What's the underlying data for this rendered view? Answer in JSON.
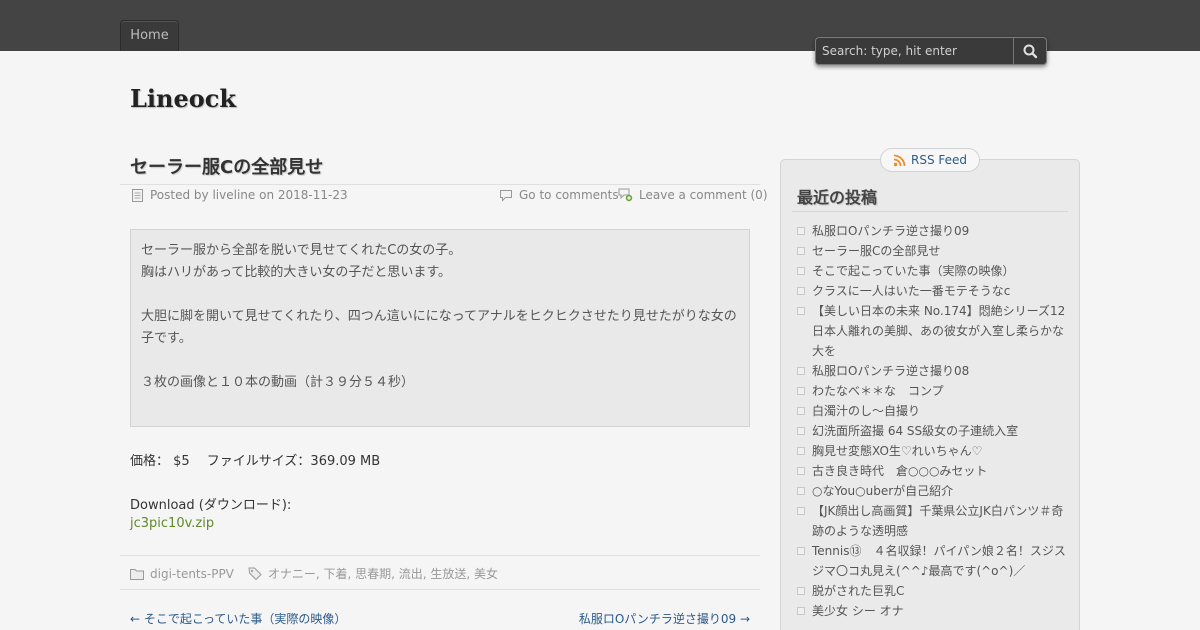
{
  "nav": {
    "home_label": "Home"
  },
  "search": {
    "placeholder": "Search: type, hit enter"
  },
  "site": {
    "title": "Lineock"
  },
  "post": {
    "title": "セーラー服Cの全部見せ",
    "posted_by_prefix": "Posted by",
    "author": "liveline",
    "date_prefix": "on",
    "date": "2018-11-23",
    "go_to_comments": "Go to comments",
    "leave_comment": "Leave a comment (0)",
    "body": [
      "セーラー服から全部を脱いで見せてくれたCの女の子。",
      "胸はハリがあって比較的大きい女の子だと思います。",
      "大胆に脚を開いて見せてくれたり、四つん這いにになってアナルをヒクヒクさせたり見せたがりな女の",
      "子です。",
      "３枚の画像と１０本の動画（計３９分５４秒）"
    ],
    "price_line": "価格： $5　 ファイルサイズ：369.09 MB",
    "download_label": "Download (ダウンロード):",
    "download_file": "jc3pic10v.zip",
    "category": "digi-tents-PPV",
    "tags": "オナニー, 下着, 思春期, 流出, 生放送, 美女",
    "prev_post": "← そこで起こっていた事（実際の映像）",
    "next_post": "私服ロOパンチラ逆さ撮り09 →"
  },
  "sidebar": {
    "rss_label": "RSS Feed",
    "recent_title": "最近の投稿",
    "recent_posts": [
      "私服ロOパンチラ逆さ撮り09",
      "セーラー服Cの全部見せ",
      "そこで起こっていた事（実際の映像）",
      "クラスに一人はいた一番モテそうなc",
      "【美しい日本の未来 No.174】悶絶シリーズ12　日本人離れの美脚、あの彼女が入室し柔らかな大を",
      "私服ロOパンチラ逆さ撮り08",
      "わたなべ＊＊な　コンプ",
      "白濁汁のし～自撮り",
      "幻洗面所盗撮 64 SS級女の子連続入室",
      "胸見せ変態XO生♡れいちゃん♡",
      "古き良き時代　倉○○○みセット",
      "○なYou○uberが自己紹介",
      "【JK顔出し高画質】千葉県公立JK白パンツ＃奇跡のような透明感",
      "Tennis⑬　４名収録！パイパン娘２名！スジスジマ〇コ丸見え(^^♪最高です(^o^)／",
      "脱がされた巨乳C",
      "美少女 シー オナ"
    ]
  }
}
